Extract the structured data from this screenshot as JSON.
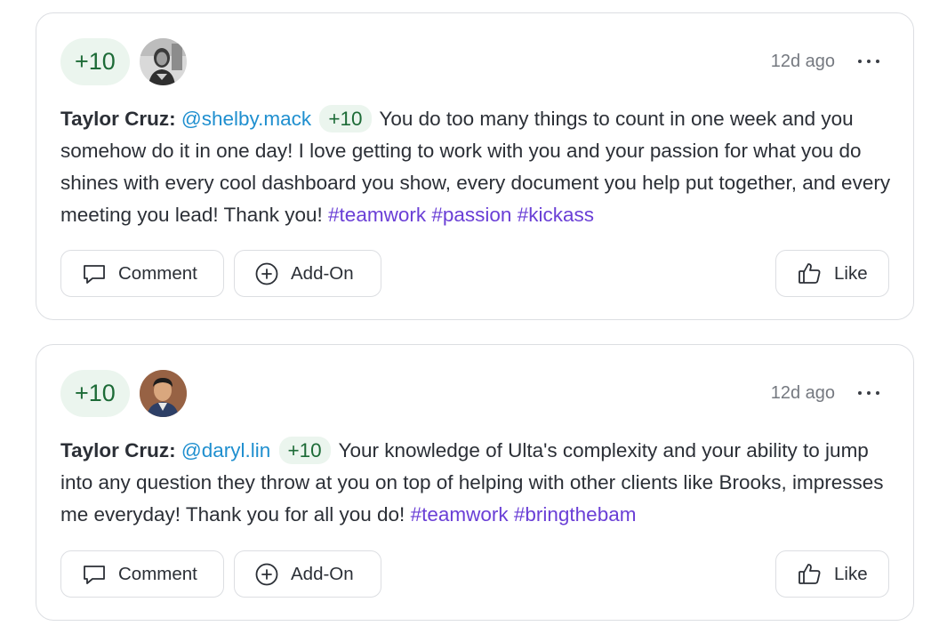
{
  "posts": [
    {
      "points": "+10",
      "time": "12d ago",
      "author": "Taylor Cruz:",
      "mention": "@shelby.mack",
      "inline_points": "+10",
      "message": "You do too many things to count in one week and you somehow do it in one day! I love getting to work with you and your passion for what you do shines with every cool dashboard you show, every document you help put together, and every meeting you lead! Thank you!",
      "hashtags": [
        "#teamwork",
        "#passion",
        "#kickass"
      ],
      "actions": {
        "comment": "Comment",
        "addon": "Add-On",
        "like": "Like"
      }
    },
    {
      "points": "+10",
      "time": "12d ago",
      "author": "Taylor Cruz:",
      "mention": "@daryl.lin",
      "inline_points": "+10",
      "message": "Your knowledge of Ulta's complexity and your ability to jump into any question they throw at you on top of helping with other clients like Brooks, impresses me everyday! Thank you for all you do!",
      "hashtags": [
        "#teamwork",
        "#bringthebam"
      ],
      "actions": {
        "comment": "Comment",
        "addon": "Add-On",
        "like": "Like"
      }
    }
  ],
  "colors": {
    "points_bg": "#ebf5ee",
    "points_text": "#1d6b37",
    "mention": "#1f8fcf",
    "hashtag": "#6a3fd6",
    "border": "#dcdee2"
  },
  "icons": [
    "comment-icon",
    "add-circle-icon",
    "thumbs-up-icon",
    "more-horizontal-icon"
  ]
}
